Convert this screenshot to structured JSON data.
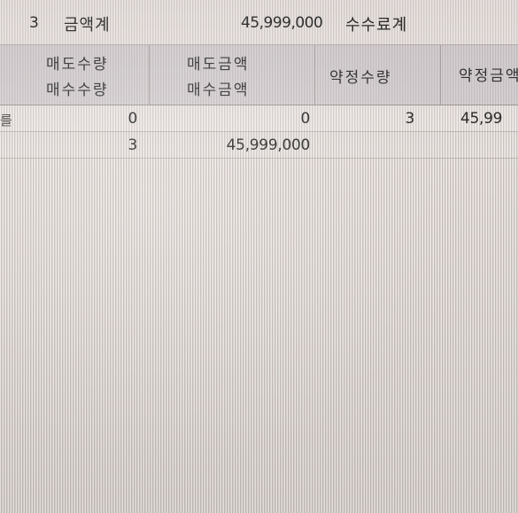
{
  "summary": {
    "count": "3",
    "amount_label": "금액계",
    "amount_value": "45,999,000",
    "fee_label": "수수료계"
  },
  "header": {
    "col1_line1": "매도수량",
    "col1_line2": "매수수량",
    "col2_line1": "매도금액",
    "col2_line2": "매수금액",
    "col3": "약정수량",
    "col4": "약정금액"
  },
  "rows": [
    {
      "marker": "를",
      "sell_qty": "0",
      "sell_amount": "0",
      "trade_qty": "3",
      "trade_amount": "45,99"
    },
    {
      "marker": "",
      "buy_qty": "3",
      "buy_amount": "45,999,000"
    }
  ]
}
